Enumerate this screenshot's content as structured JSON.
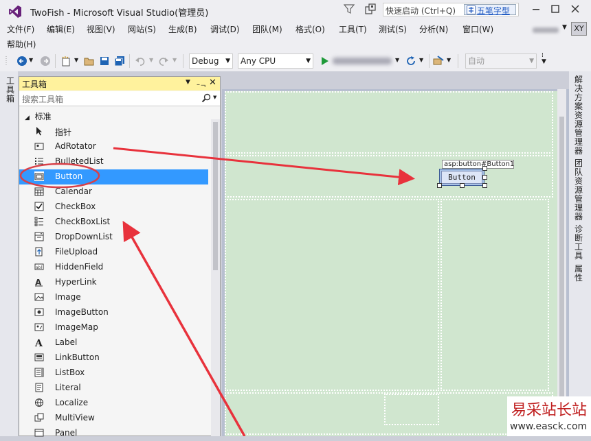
{
  "app": {
    "title": "TwoFish - Microsoft Visual Studio(管理员)",
    "quick_launch_placeholder": "快速启动 (Ctrl+Q)",
    "ime_label": "五笔字型",
    "user_initials": "XY"
  },
  "menu": [
    "文件(F)",
    "编辑(E)",
    "视图(V)",
    "网站(S)",
    "生成(B)",
    "调试(D)",
    "团队(M)",
    "格式(O)",
    "工具(T)",
    "测试(S)",
    "分析(N)",
    "窗口(W)",
    "帮助(H)"
  ],
  "toolbar": {
    "config": "Debug",
    "platform": "Any CPU",
    "auto_combo": "自动"
  },
  "left_tab": "工具箱",
  "toolbox": {
    "title": "工具箱",
    "search_placeholder": "搜索工具箱",
    "group": "标准",
    "items": [
      {
        "label": "指针",
        "icon": "pointer-icon"
      },
      {
        "label": "AdRotator",
        "icon": "adrotator-icon"
      },
      {
        "label": "BulletedList",
        "icon": "bulletedlist-icon"
      },
      {
        "label": "Button",
        "icon": "button-icon",
        "selected": true
      },
      {
        "label": "Calendar",
        "icon": "calendar-icon"
      },
      {
        "label": "CheckBox",
        "icon": "checkbox-icon"
      },
      {
        "label": "CheckBoxList",
        "icon": "checkboxlist-icon"
      },
      {
        "label": "DropDownList",
        "icon": "dropdownlist-icon"
      },
      {
        "label": "FileUpload",
        "icon": "fileupload-icon"
      },
      {
        "label": "HiddenField",
        "icon": "hiddenfield-icon"
      },
      {
        "label": "HyperLink",
        "icon": "hyperlink-icon"
      },
      {
        "label": "Image",
        "icon": "image-icon"
      },
      {
        "label": "ImageButton",
        "icon": "imagebutton-icon"
      },
      {
        "label": "ImageMap",
        "icon": "imagemap-icon"
      },
      {
        "label": "Label",
        "icon": "label-icon"
      },
      {
        "label": "LinkButton",
        "icon": "linkbutton-icon"
      },
      {
        "label": "ListBox",
        "icon": "listbox-icon"
      },
      {
        "label": "Literal",
        "icon": "literal-icon"
      },
      {
        "label": "Localize",
        "icon": "localize-icon"
      },
      {
        "label": "MultiView",
        "icon": "multiview-icon"
      },
      {
        "label": "Panel",
        "icon": "panel-icon"
      }
    ]
  },
  "designer": {
    "control_tag": "asp:button#Button1",
    "button_text": "Button"
  },
  "right_tabs": [
    "解决方案资源管理器",
    "团队资源管理器",
    "诊断工具",
    "属性"
  ],
  "watermark": {
    "text": "易采站长站",
    "url": "www.easck.com"
  },
  "colors": {
    "accent_select": "#3399ff",
    "toolbox_header": "#fff29d",
    "design_surface": "#d0e6cf",
    "annotation": "#e8323c",
    "vs_purple": "#68217a"
  }
}
